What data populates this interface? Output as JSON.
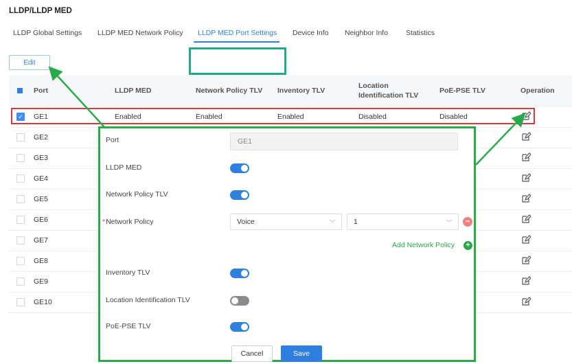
{
  "page": {
    "title": "LLDP/LLDP MED"
  },
  "tabs": [
    {
      "label": "LLDP Global Settings"
    },
    {
      "label": "LLDP MED Network Policy"
    },
    {
      "label": "LLDP MED Port Settings"
    },
    {
      "label": "Device Info"
    },
    {
      "label": "Neighbor Info"
    },
    {
      "label": "Statistics"
    }
  ],
  "active_tab": "LLDP MED Port Settings",
  "toolbar": {
    "edit_label": "Edit"
  },
  "table": {
    "headers": {
      "port": "Port",
      "lldp_med": "LLDP MED",
      "network_policy_tlv": "Network Policy TLV",
      "inventory_tlv": "Inventory TLV",
      "location_line1": "Location",
      "location_line2": "Identification TLV",
      "poe_pse_tlv": "PoE-PSE TLV",
      "operation": "Operation"
    },
    "rows": [
      {
        "port": "GE1",
        "checked": true,
        "lldp_med": "Enabled",
        "network_policy_tlv": "Enabled",
        "inventory_tlv": "Enabled",
        "location_tlv": "Disabled",
        "poe_pse_tlv": "Disabled"
      },
      {
        "port": "GE2"
      },
      {
        "port": "GE3"
      },
      {
        "port": "GE4"
      },
      {
        "port": "GE5"
      },
      {
        "port": "GE6"
      },
      {
        "port": "GE7"
      },
      {
        "port": "GE8"
      },
      {
        "port": "GE9"
      },
      {
        "port": "GE10"
      }
    ]
  },
  "modal": {
    "port_label": "Port",
    "port_value": "GE1",
    "lldp_med_label": "LLDP MED",
    "lldp_med_on": true,
    "network_policy_tlv_label": "Network Policy TLV",
    "network_policy_tlv_on": true,
    "required_mark": "*",
    "network_policy_label": "Network Policy",
    "network_policy_type": "Voice",
    "network_policy_id": "1",
    "add_network_policy": "Add Network Policy",
    "inventory_tlv_label": "Inventory TLV",
    "inventory_tlv_on": true,
    "location_tlv_label": "Location Identification TLV",
    "location_tlv_on": false,
    "poe_pse_tlv_label": "PoE-PSE TLV",
    "poe_pse_tlv_on": true,
    "cancel_label": "Cancel",
    "save_label": "Save"
  },
  "colors": {
    "accent": "#2f7fe0",
    "annotation_green": "#29a94a",
    "annotation_teal": "#1faa8a",
    "annotation_red": "#d9363e"
  },
  "icons": [
    "check-icon",
    "edit-icon",
    "chevron-down-icon",
    "minus-circle-icon",
    "plus-circle-icon"
  ]
}
